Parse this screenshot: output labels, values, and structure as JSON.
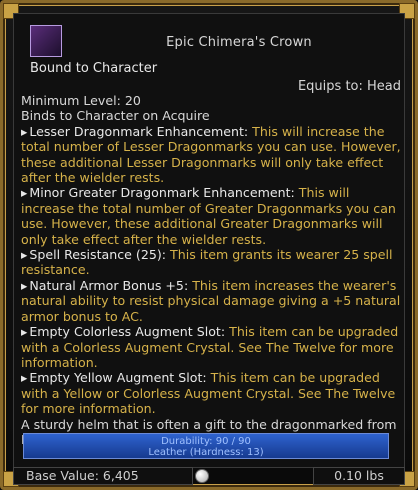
{
  "item": {
    "name": "Epic Chimera's Crown",
    "bound": "Bound to Character",
    "equips_to": "Equips to: Head",
    "minimum_level": "Minimum Level: 20",
    "binds": "Binds to Character on Acquire"
  },
  "effects": [
    {
      "name": "Lesser Dragonmark Enhancement:",
      "description": "This will increase the total number of Lesser Dragonmarks you can use. However, these additional Lesser Dragonmarks will only take effect after the wielder rests."
    },
    {
      "name": "Minor Greater Dragonmark Enhancement:",
      "description": "This will increase the total number of Greater Dragonmarks you can use. However, these additional Greater Dragonmarks will only take effect after the wielder rests."
    },
    {
      "name": "Spell Resistance (25):",
      "description": "This item grants its wearer 25 spell resistance."
    },
    {
      "name": "Natural Armor Bonus +5:",
      "description": "This item increases the wearer's natural ability to resist physical damage giving a +5 natural armor bonus to AC."
    },
    {
      "name": "Empty Colorless Augment Slot:",
      "description": "This item can be upgraded with a Colorless Augment Crystal. See The Twelve for more information."
    },
    {
      "name": "Empty Yellow Augment Slot:",
      "description": "This item can be upgraded with a Yellow or Colorless Augment Crystal. See The Twelve for more information."
    }
  ],
  "flavor_text": "A sturdy helm that is often a gift to the dragonmarked from House Deneith.",
  "durability": {
    "label": "Durability: 90 / 90",
    "material": "Leather (Hardness: 13)",
    "fraction": 1.0
  },
  "footer": {
    "base_value": "Base Value: 6,405",
    "weight": "0.10 lbs"
  },
  "colors": {
    "effect_name": "#e8e8e8",
    "effect_desc": "#d6b24a",
    "frame_gold": "#c9a245",
    "durability_blue": "#1d4aa8"
  },
  "icons": {
    "item_icon": "chimera-crown-icon",
    "coin_icon": "coin-icon"
  }
}
